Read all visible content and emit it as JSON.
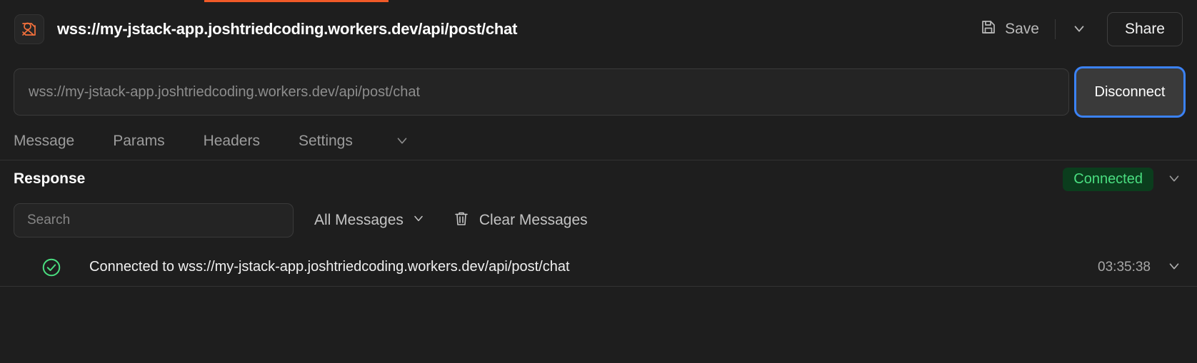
{
  "window": {
    "title": "wss://my-jstack-app.joshtriedcoding.workers.dev/api/post/chat",
    "app_icon": "websocket-app-icon",
    "accent_color": "#f05a28"
  },
  "titlebar": {
    "save_label": "Save",
    "save_icon": "floppy-disk-icon",
    "save_menu_icon": "chevron-down-icon",
    "share_label": "Share"
  },
  "connection": {
    "url_value": "",
    "url_placeholder": "wss://my-jstack-app.joshtriedcoding.workers.dev/api/post/chat",
    "action_label": "Disconnect",
    "focus_ring_color": "#3b82f6"
  },
  "tabs": [
    {
      "label": "Message",
      "active": false
    },
    {
      "label": "Params",
      "active": false
    },
    {
      "label": "Headers",
      "active": false
    },
    {
      "label": "Settings",
      "active": false
    }
  ],
  "tabs_overflow_icon": "chevron-down-icon",
  "response": {
    "title": "Response",
    "status_label": "Connected",
    "status_color": "#4ade80",
    "status_bg": "#0b3d1d",
    "collapse_icon": "chevron-down-icon"
  },
  "toolbar": {
    "search_value": "",
    "search_placeholder": "Search",
    "filter_label": "All Messages",
    "filter_icon": "chevron-down-icon",
    "clear_label": "Clear Messages",
    "clear_icon": "trash-icon"
  },
  "messages": [
    {
      "status_icon": "circle-check-icon",
      "status_color": "#4ade80",
      "text": "Connected to wss://my-jstack-app.joshtriedcoding.workers.dev/api/post/chat",
      "time": "03:35:38",
      "expand_icon": "chevron-down-icon"
    }
  ]
}
